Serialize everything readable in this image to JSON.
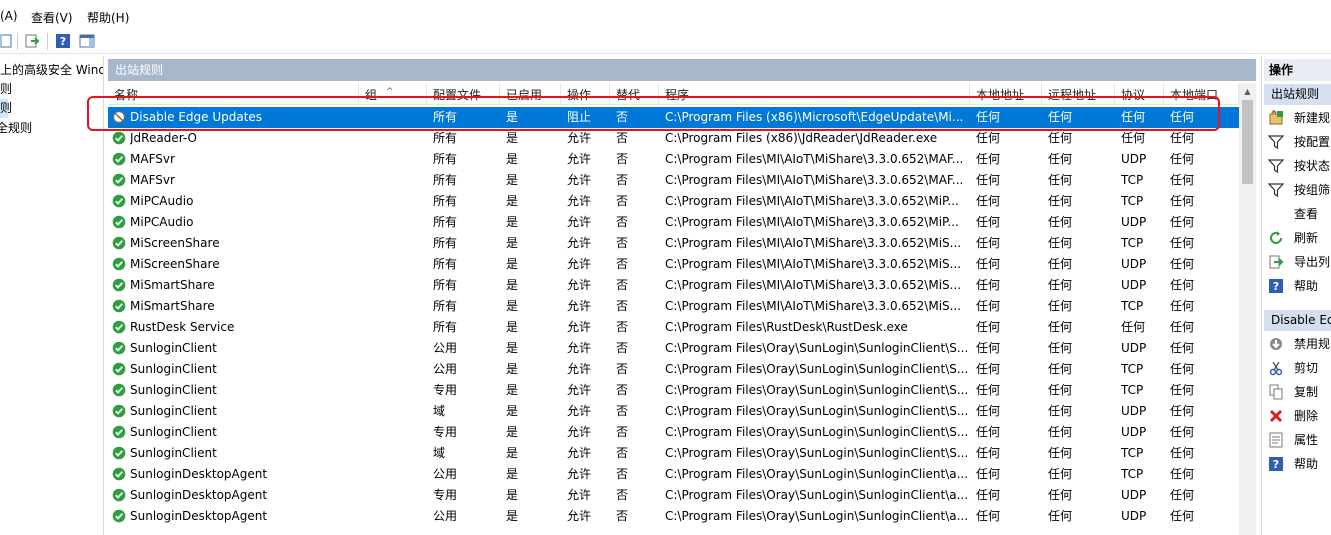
{
  "menu": {
    "items": [
      "(A)",
      "查看(V)",
      "帮助(H)"
    ]
  },
  "tree": {
    "items": [
      {
        "label": "上的高级安全 Wind",
        "selected": false
      },
      {
        "label": "则",
        "selected": false
      },
      {
        "label": "则",
        "selected": true
      },
      {
        "label": "全规则",
        "selected": false
      }
    ]
  },
  "main": {
    "title": "出站规则",
    "columns": [
      "名称",
      "组",
      "配置文件",
      "已启用",
      "操作",
      "替代",
      "程序",
      "本地地址",
      "远程地址",
      "协议",
      "本地端口"
    ],
    "rows": [
      {
        "name": "Disable Edge Updates",
        "icon": "block-icon",
        "group": "",
        "profile": "所有",
        "enabled": "是",
        "action": "阻止",
        "override": "否",
        "program": "C:\\Program Files (x86)\\Microsoft\\EdgeUpdate\\Mi...",
        "local": "任何",
        "remote": "任何",
        "protocol": "任何",
        "lport": "任何"
      },
      {
        "name": "JdReader-O",
        "icon": "allow-icon",
        "group": "",
        "profile": "所有",
        "enabled": "是",
        "action": "允许",
        "override": "否",
        "program": "C:\\Program Files (x86)\\JdReader\\JdReader.exe",
        "local": "任何",
        "remote": "任何",
        "protocol": "任何",
        "lport": "任何"
      },
      {
        "name": "MAFSvr",
        "icon": "allow-icon",
        "group": "",
        "profile": "所有",
        "enabled": "是",
        "action": "允许",
        "override": "否",
        "program": "C:\\Program Files\\MI\\AIoT\\MiShare\\3.3.0.652\\MAF...",
        "local": "任何",
        "remote": "任何",
        "protocol": "UDP",
        "lport": "任何"
      },
      {
        "name": "MAFSvr",
        "icon": "allow-icon",
        "group": "",
        "profile": "所有",
        "enabled": "是",
        "action": "允许",
        "override": "否",
        "program": "C:\\Program Files\\MI\\AIoT\\MiShare\\3.3.0.652\\MAF...",
        "local": "任何",
        "remote": "任何",
        "protocol": "TCP",
        "lport": "任何"
      },
      {
        "name": "MiPCAudio",
        "icon": "allow-icon",
        "group": "",
        "profile": "所有",
        "enabled": "是",
        "action": "允许",
        "override": "否",
        "program": "C:\\Program Files\\MI\\AIoT\\MiShare\\3.3.0.652\\MiP...",
        "local": "任何",
        "remote": "任何",
        "protocol": "TCP",
        "lport": "任何"
      },
      {
        "name": "MiPCAudio",
        "icon": "allow-icon",
        "group": "",
        "profile": "所有",
        "enabled": "是",
        "action": "允许",
        "override": "否",
        "program": "C:\\Program Files\\MI\\AIoT\\MiShare\\3.3.0.652\\MiP...",
        "local": "任何",
        "remote": "任何",
        "protocol": "UDP",
        "lport": "任何"
      },
      {
        "name": "MiScreenShare",
        "icon": "allow-icon",
        "group": "",
        "profile": "所有",
        "enabled": "是",
        "action": "允许",
        "override": "否",
        "program": "C:\\Program Files\\MI\\AIoT\\MiShare\\3.3.0.652\\MiS...",
        "local": "任何",
        "remote": "任何",
        "protocol": "TCP",
        "lport": "任何"
      },
      {
        "name": "MiScreenShare",
        "icon": "allow-icon",
        "group": "",
        "profile": "所有",
        "enabled": "是",
        "action": "允许",
        "override": "否",
        "program": "C:\\Program Files\\MI\\AIoT\\MiShare\\3.3.0.652\\MiS...",
        "local": "任何",
        "remote": "任何",
        "protocol": "UDP",
        "lport": "任何"
      },
      {
        "name": "MiSmartShare",
        "icon": "allow-icon",
        "group": "",
        "profile": "所有",
        "enabled": "是",
        "action": "允许",
        "override": "否",
        "program": "C:\\Program Files\\MI\\AIoT\\MiShare\\3.3.0.652\\MiS...",
        "local": "任何",
        "remote": "任何",
        "protocol": "UDP",
        "lport": "任何"
      },
      {
        "name": "MiSmartShare",
        "icon": "allow-icon",
        "group": "",
        "profile": "所有",
        "enabled": "是",
        "action": "允许",
        "override": "否",
        "program": "C:\\Program Files\\MI\\AIoT\\MiShare\\3.3.0.652\\MiS...",
        "local": "任何",
        "remote": "任何",
        "protocol": "TCP",
        "lport": "任何"
      },
      {
        "name": "RustDesk Service",
        "icon": "allow-icon",
        "group": "",
        "profile": "所有",
        "enabled": "是",
        "action": "允许",
        "override": "否",
        "program": "C:\\Program Files\\RustDesk\\RustDesk.exe",
        "local": "任何",
        "remote": "任何",
        "protocol": "任何",
        "lport": "任何"
      },
      {
        "name": "SunloginClient",
        "icon": "allow-icon",
        "group": "",
        "profile": "公用",
        "enabled": "是",
        "action": "允许",
        "override": "否",
        "program": "C:\\Program Files\\Oray\\SunLogin\\SunloginClient\\S...",
        "local": "任何",
        "remote": "任何",
        "protocol": "UDP",
        "lport": "任何"
      },
      {
        "name": "SunloginClient",
        "icon": "allow-icon",
        "group": "",
        "profile": "公用",
        "enabled": "是",
        "action": "允许",
        "override": "否",
        "program": "C:\\Program Files\\Oray\\SunLogin\\SunloginClient\\S...",
        "local": "任何",
        "remote": "任何",
        "protocol": "TCP",
        "lport": "任何"
      },
      {
        "name": "SunloginClient",
        "icon": "allow-icon",
        "group": "",
        "profile": "专用",
        "enabled": "是",
        "action": "允许",
        "override": "否",
        "program": "C:\\Program Files\\Oray\\SunLogin\\SunloginClient\\S...",
        "local": "任何",
        "remote": "任何",
        "protocol": "TCP",
        "lport": "任何"
      },
      {
        "name": "SunloginClient",
        "icon": "allow-icon",
        "group": "",
        "profile": "域",
        "enabled": "是",
        "action": "允许",
        "override": "否",
        "program": "C:\\Program Files\\Oray\\SunLogin\\SunloginClient\\S...",
        "local": "任何",
        "remote": "任何",
        "protocol": "UDP",
        "lport": "任何"
      },
      {
        "name": "SunloginClient",
        "icon": "allow-icon",
        "group": "",
        "profile": "专用",
        "enabled": "是",
        "action": "允许",
        "override": "否",
        "program": "C:\\Program Files\\Oray\\SunLogin\\SunloginClient\\S...",
        "local": "任何",
        "remote": "任何",
        "protocol": "UDP",
        "lport": "任何"
      },
      {
        "name": "SunloginClient",
        "icon": "allow-icon",
        "group": "",
        "profile": "域",
        "enabled": "是",
        "action": "允许",
        "override": "否",
        "program": "C:\\Program Files\\Oray\\SunLogin\\SunloginClient\\S...",
        "local": "任何",
        "remote": "任何",
        "protocol": "TCP",
        "lport": "任何"
      },
      {
        "name": "SunloginDesktopAgent",
        "icon": "allow-icon",
        "group": "",
        "profile": "公用",
        "enabled": "是",
        "action": "允许",
        "override": "否",
        "program": "C:\\Program Files\\Oray\\SunLogin\\SunloginClient\\a...",
        "local": "任何",
        "remote": "任何",
        "protocol": "TCP",
        "lport": "任何"
      },
      {
        "name": "SunloginDesktopAgent",
        "icon": "allow-icon",
        "group": "",
        "profile": "专用",
        "enabled": "是",
        "action": "允许",
        "override": "否",
        "program": "C:\\Program Files\\Oray\\SunLogin\\SunloginClient\\a...",
        "local": "任何",
        "remote": "任何",
        "protocol": "UDP",
        "lport": "任何"
      },
      {
        "name": "SunloginDesktopAgent",
        "icon": "allow-icon",
        "group": "",
        "profile": "公用",
        "enabled": "是",
        "action": "允许",
        "override": "否",
        "program": "C:\\Program Files\\Oray\\SunLogin\\SunloginClient\\a...",
        "local": "任何",
        "remote": "任何",
        "protocol": "UDP",
        "lport": "任何"
      }
    ]
  },
  "actions": {
    "title": "操作",
    "section1": "出站规则",
    "section1_items": [
      {
        "label": "新建规",
        "icon": "new-rule-icon"
      },
      {
        "label": "按配置",
        "icon": "filter-icon"
      },
      {
        "label": "按状态",
        "icon": "filter-icon"
      },
      {
        "label": "按组筛",
        "icon": "filter-icon"
      },
      {
        "label": "查看",
        "icon": ""
      },
      {
        "label": "刷新",
        "icon": "refresh-icon"
      },
      {
        "label": "导出列",
        "icon": "export-icon"
      },
      {
        "label": "帮助",
        "icon": "help-icon"
      }
    ],
    "section2": "Disable Ed",
    "section2_items": [
      {
        "label": "禁用规",
        "icon": "disable-icon"
      },
      {
        "label": "剪切",
        "icon": "cut-icon"
      },
      {
        "label": "复制",
        "icon": "copy-icon"
      },
      {
        "label": "删除",
        "icon": "delete-icon"
      },
      {
        "label": "属性",
        "icon": "properties-icon"
      },
      {
        "label": "帮助",
        "icon": "help-icon"
      }
    ]
  },
  "colors": {
    "selection": "#0078d7",
    "allow": "#2e9e3e",
    "title_bar": "#a8b8cc",
    "highlight": "#e81123"
  }
}
